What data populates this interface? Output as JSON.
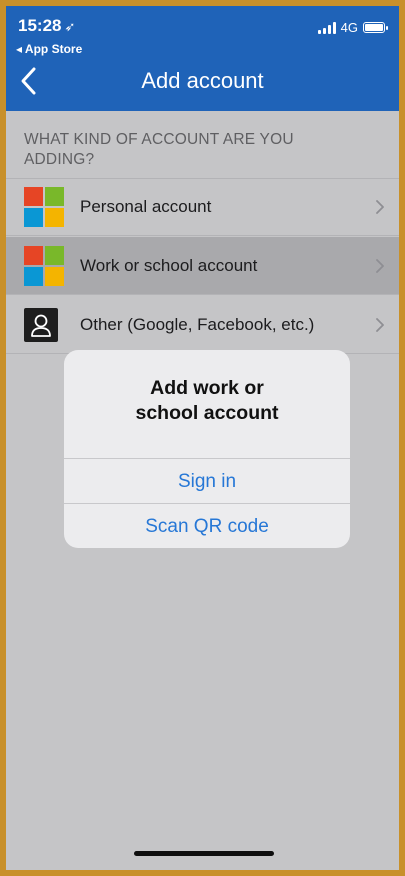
{
  "status_bar": {
    "time": "15:28",
    "back_app": "◂ App Store",
    "network": "4G"
  },
  "navbar": {
    "title": "Add account"
  },
  "section": {
    "header": "WHAT KIND OF ACCOUNT ARE YOU ADDING?"
  },
  "accounts": [
    {
      "label": "Personal account",
      "icon": "microsoft-logo-icon"
    },
    {
      "label": "Work or school account",
      "icon": "microsoft-logo-icon"
    },
    {
      "label": "Other (Google, Facebook, etc.)",
      "icon": "person-icon"
    }
  ],
  "dialog": {
    "title_line1": "Add work or",
    "title_line2": "school account",
    "sign_in_label": "Sign in",
    "scan_qr_label": "Scan QR code"
  },
  "colors": {
    "brand_blue": "#1f63b8",
    "link_blue": "#2677d6"
  }
}
